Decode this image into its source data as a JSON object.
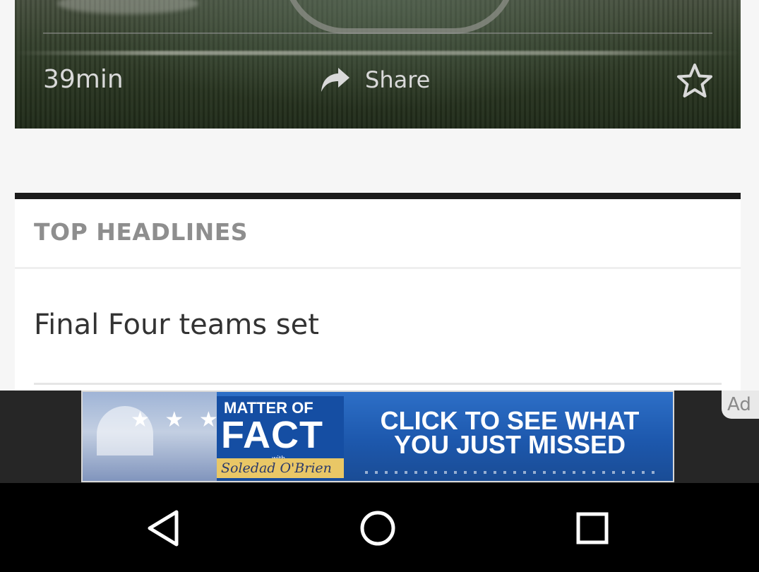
{
  "video": {
    "duration": "39min",
    "share_label": "Share",
    "share_icon": "share-arrow-icon",
    "favorite_icon": "star-outline-icon"
  },
  "headlines": {
    "section_title": "TOP HEADLINES",
    "items": [
      {
        "title": "Final Four teams set"
      }
    ]
  },
  "ad": {
    "banner": {
      "logo_top": "MATTER OF",
      "logo_main": "FACT",
      "logo_with": "with",
      "logo_host": "Soledad O'Brien",
      "cta_line1": "CLICK TO SEE WHAT",
      "cta_line2": "YOU JUST MISSED",
      "stars": "★ ★ ★"
    },
    "badge_label": "Ad"
  },
  "navbar": {
    "back_icon": "back-triangle-icon",
    "home_icon": "home-circle-icon",
    "recents_icon": "recents-square-icon"
  },
  "colors": {
    "page_bg": "#f6f6f6",
    "section_border": "#1c1c1c",
    "section_title": "#8e8e8e",
    "headline_text": "#333333",
    "ad_blue": "#1d58ad",
    "navbar_bg": "#000000"
  }
}
